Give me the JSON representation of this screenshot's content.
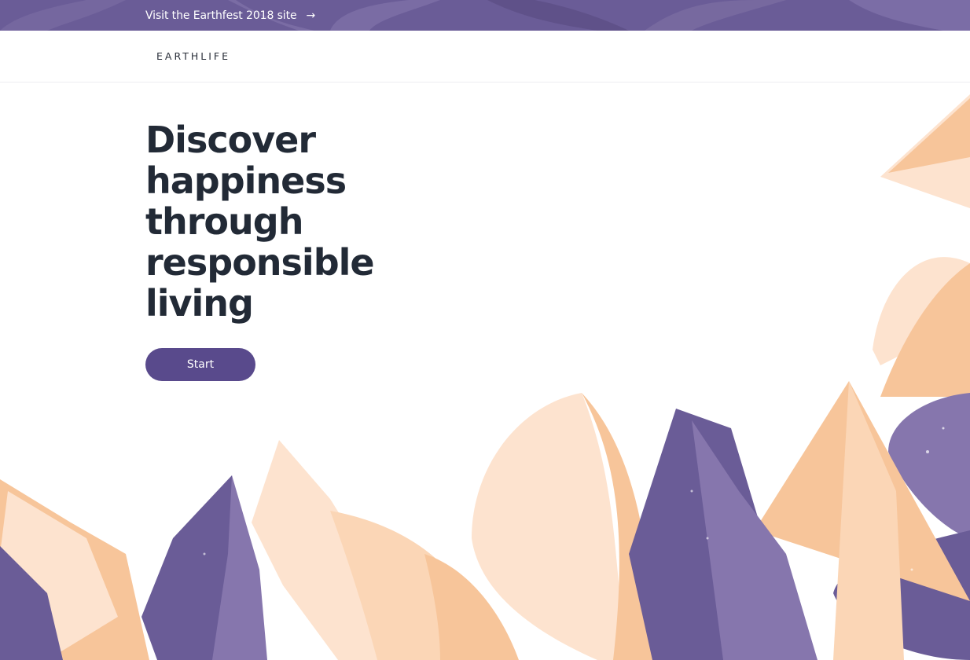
{
  "topbar": {
    "link_text": "Visit the Earthfest 2018 site",
    "arrow": "→"
  },
  "nav": {
    "logo": "EARTHLIFE"
  },
  "hero": {
    "title_lines": [
      "Discover",
      "happiness",
      "through",
      "responsible",
      "living"
    ],
    "cta": "Start"
  },
  "colors": {
    "purple": "#6a5c97",
    "button": "#594a8c",
    "peach": "#f7c59a",
    "light_peach": "#fde3cf",
    "lavender": "#8676ad",
    "title": "#222a36"
  }
}
